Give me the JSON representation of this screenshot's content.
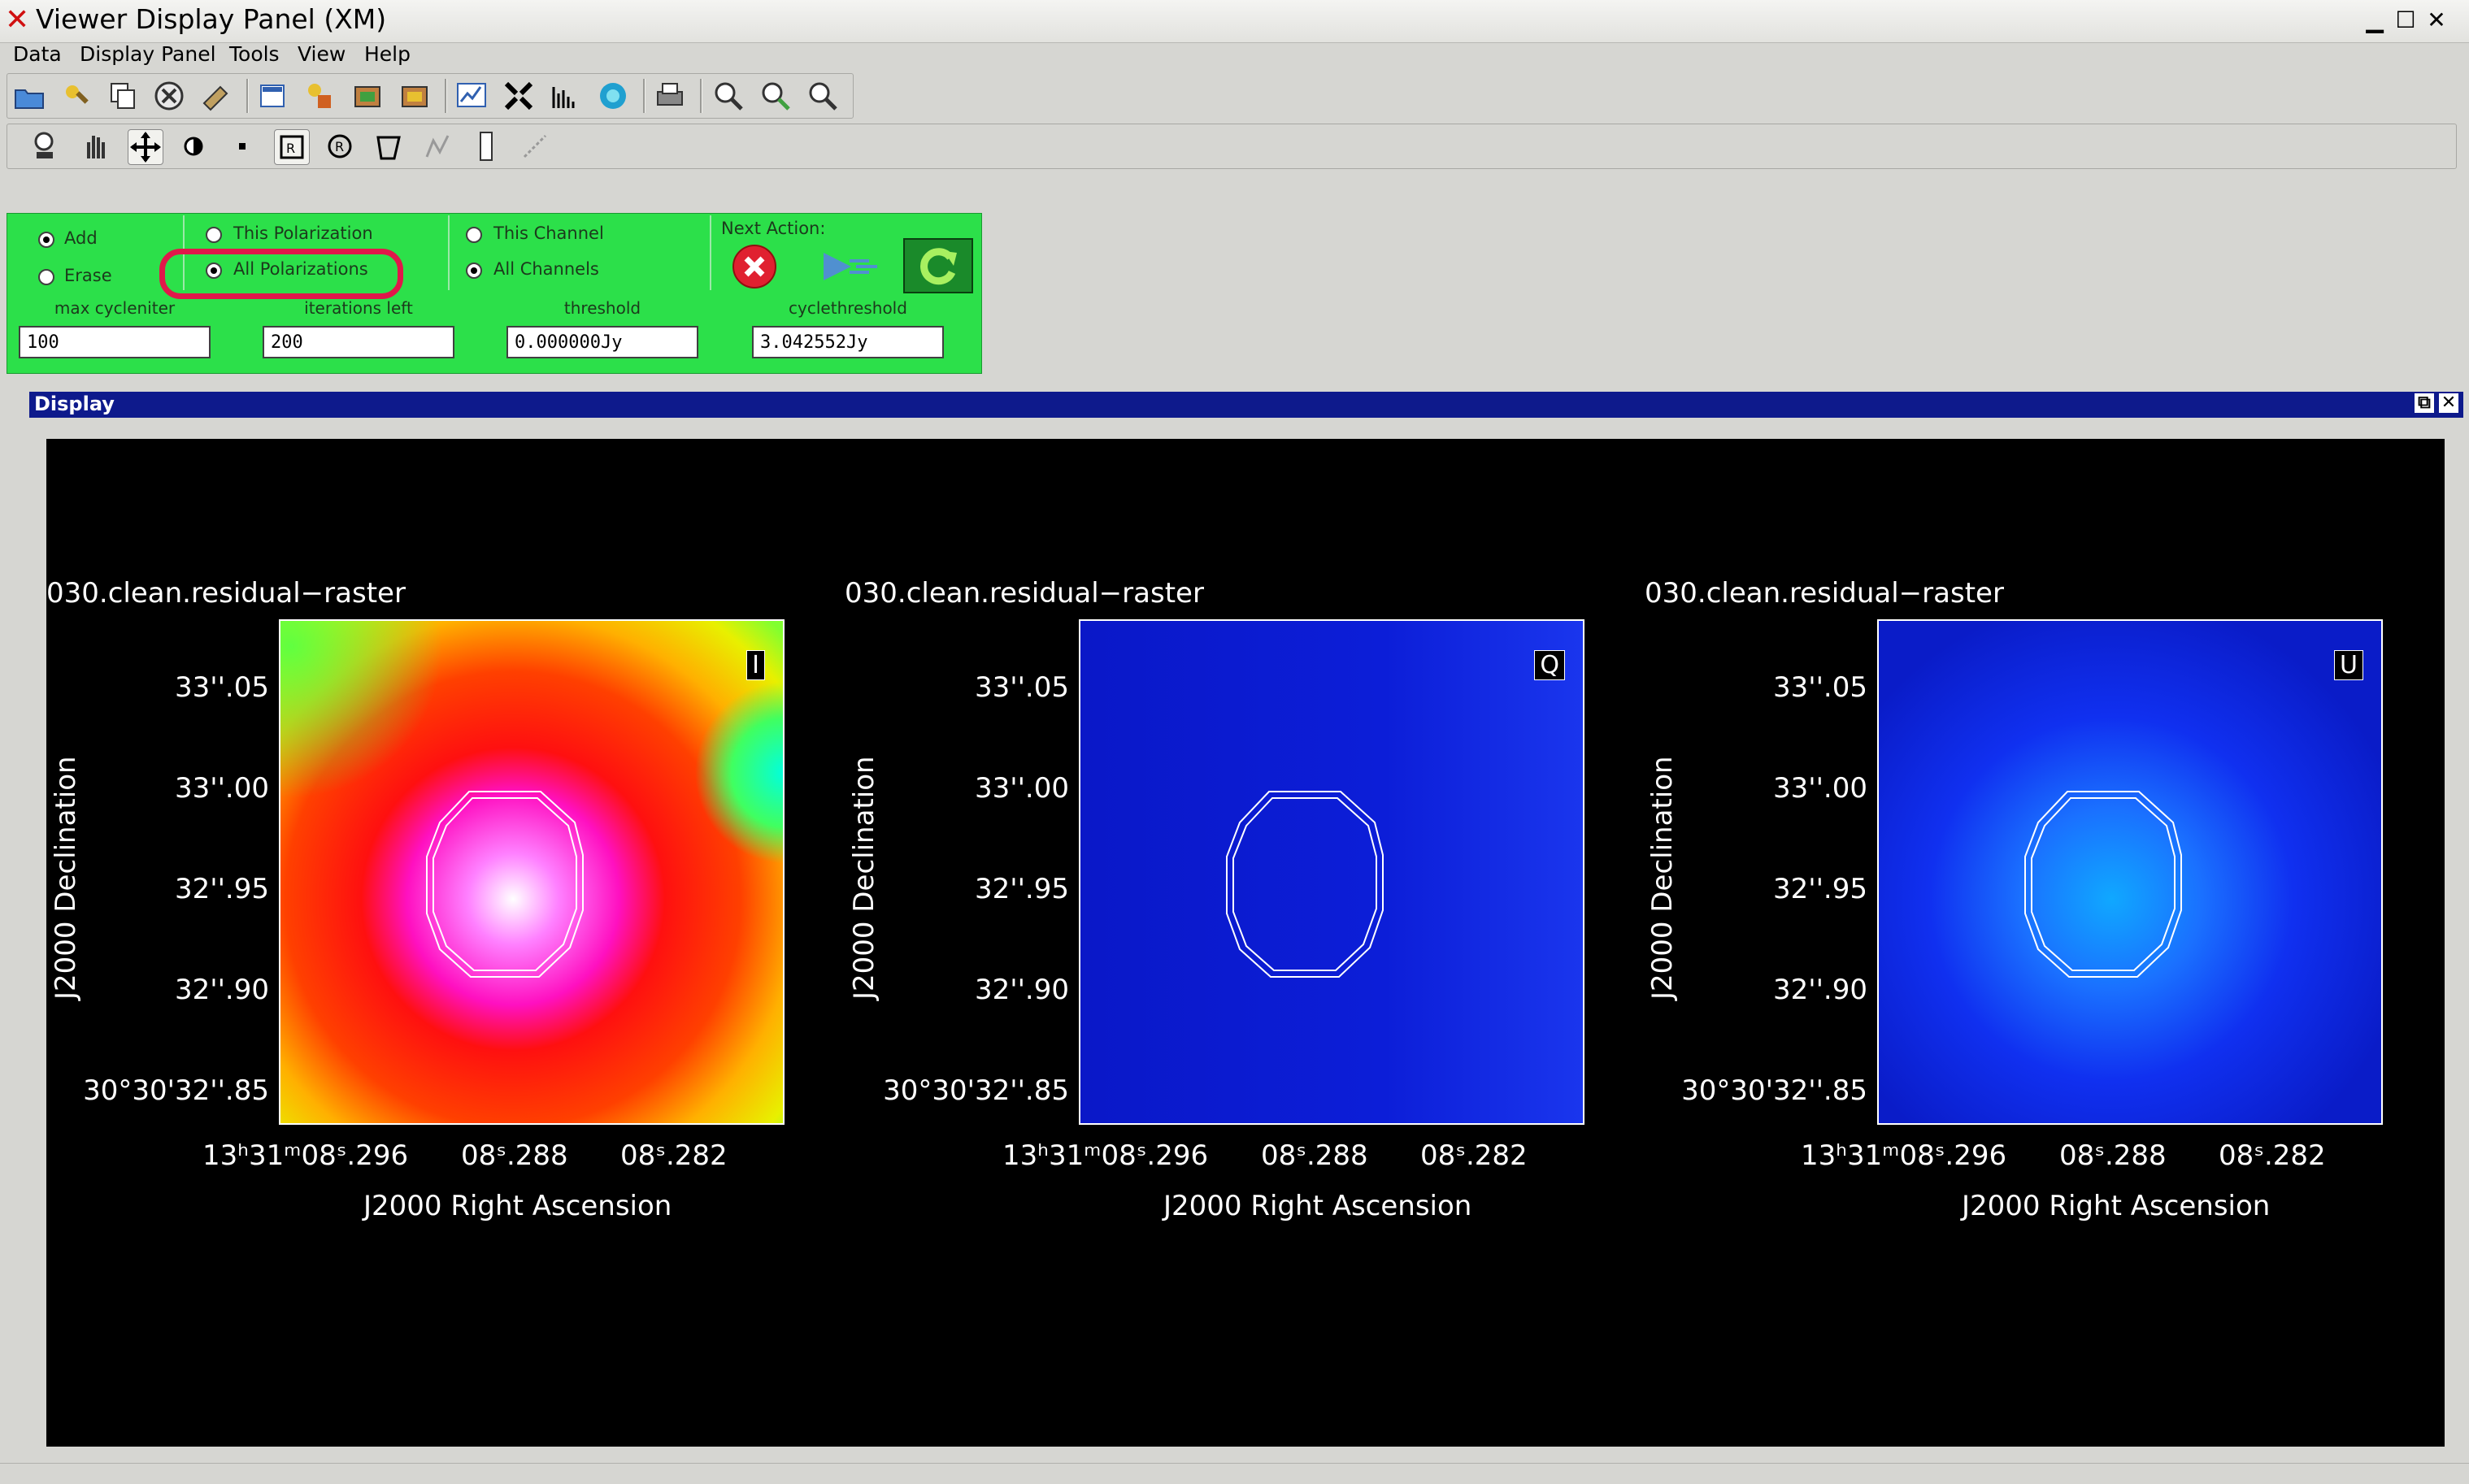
{
  "window": {
    "title": "Viewer Display Panel (XM)"
  },
  "menu": [
    "Data",
    "Display Panel",
    "Tools",
    "View",
    "Help"
  ],
  "controls": {
    "add": "Add",
    "erase": "Erase",
    "this_pol": "This Polarization",
    "all_pol": "All Polarizations",
    "this_chan": "This Channel",
    "all_chan": "All Channels",
    "next_action": "Next Action:",
    "fields": [
      {
        "label": "max cycleniter",
        "value": "100"
      },
      {
        "label": "iterations left",
        "value": "200"
      },
      {
        "label": "threshold",
        "value": "0.000000Jy"
      },
      {
        "label": "cyclethreshold",
        "value": "3.042552Jy"
      }
    ]
  },
  "display": {
    "header": "Display",
    "panels": [
      {
        "title": "030.clean.residual−raster",
        "stokes": "I"
      },
      {
        "title": "030.clean.residual−raster",
        "stokes": "Q"
      },
      {
        "title": "030.clean.residual−raster",
        "stokes": "U"
      }
    ],
    "yticks": [
      "33''.05",
      "33''.00",
      "32''.95",
      "32''.90",
      "30°30'32''.85"
    ],
    "xticks": [
      "13ʰ31ᵐ08ˢ.296",
      "08ˢ.288",
      "08ˢ.282"
    ],
    "xlabel": "J2000 Right Ascension",
    "ylabel": "J2000 Declination"
  },
  "colors": {
    "green_panel": "#2ce04a",
    "display_header": "#0e1a8c",
    "highlight": "#e0184a"
  }
}
